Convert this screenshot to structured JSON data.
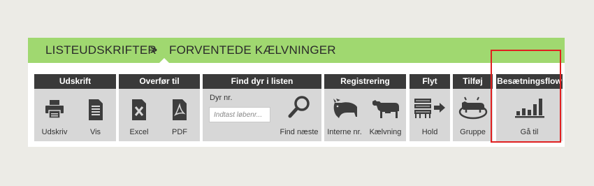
{
  "breadcrumb": {
    "items": [
      "LISTEUDSKRIFTER",
      "FORVENTEDE KÆLVNINGER"
    ],
    "separator": ">"
  },
  "toolbar": {
    "groups": [
      {
        "title": "Udskrift",
        "tools": [
          {
            "label": "Udskriv",
            "icon": "printer-icon"
          },
          {
            "label": "Vis",
            "icon": "document-icon"
          }
        ]
      },
      {
        "title": "Overfør til",
        "tools": [
          {
            "label": "Excel",
            "icon": "excel-icon"
          },
          {
            "label": "PDF",
            "icon": "pdf-icon"
          }
        ]
      },
      {
        "title": "Find dyr i listen",
        "field_label": "Dyr nr.",
        "placeholder": "Indtast løbenr...",
        "tools": [
          {
            "label": "Find næste",
            "icon": "magnifier-icon"
          }
        ]
      },
      {
        "title": "Registrering",
        "tools": [
          {
            "label": "Interne nr.",
            "icon": "cow-head-icon"
          },
          {
            "label": "Kælvning",
            "icon": "cow-icon"
          }
        ]
      },
      {
        "title": "Flyt",
        "tools": [
          {
            "label": "Hold",
            "icon": "herd-move-icon"
          }
        ]
      },
      {
        "title": "Tilføj",
        "tools": [
          {
            "label": "Gruppe",
            "icon": "group-cow-icon"
          }
        ]
      },
      {
        "title": "Besætningsflow",
        "tools": [
          {
            "label": "Gå til",
            "icon": "bar-chart-icon"
          }
        ]
      }
    ]
  },
  "colors": {
    "header_green": "#a0d870",
    "group_header": "#3a3a3a",
    "tool_background": "#d7d7d7",
    "highlight": "#e02020",
    "icon": "#3d3d3d"
  }
}
